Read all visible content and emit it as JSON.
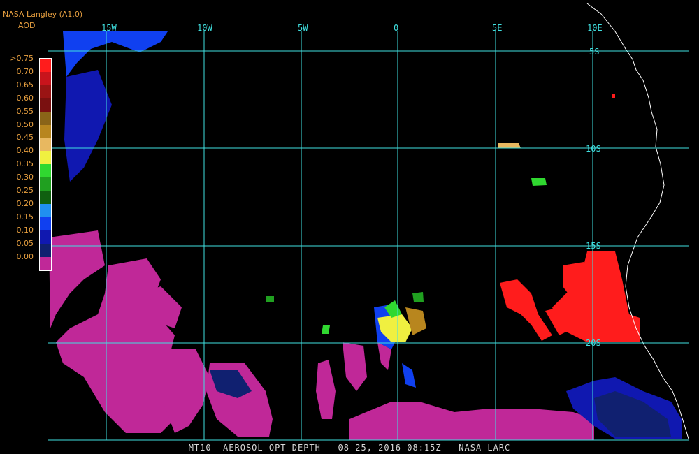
{
  "header": {
    "source": "NASA Langley (A1.0)",
    "product": "AOD"
  },
  "color_scale": {
    "labels": [
      ">0.75",
      "0.70",
      "0.65",
      "0.60",
      "0.55",
      "0.50",
      "0.45",
      "0.40",
      "0.35",
      "0.30",
      "0.25",
      "0.20",
      "0.15",
      "0.10",
      "0.05",
      "0.00"
    ],
    "colors": [
      "#ff1c1c",
      "#c8141c",
      "#9a1414",
      "#7a1010",
      "#8a6418",
      "#b8861e",
      "#e8b860",
      "#f0f040",
      "#30d830",
      "#20a020",
      "#106010",
      "#2090f0",
      "#1040f0",
      "#1018b0",
      "#102070",
      "#c02898"
    ]
  },
  "grid": {
    "lon_labels": [
      "15W",
      "10W",
      "5W",
      "0",
      "5E",
      "10E"
    ],
    "lat_labels": [
      "5S",
      "10S",
      "15S",
      "20S"
    ],
    "color": "#40e0e0"
  },
  "footer": {
    "caption": "MT10  AEROSOL OPT DEPTH   08 25, 2016 08:15Z   NASA LARC"
  }
}
